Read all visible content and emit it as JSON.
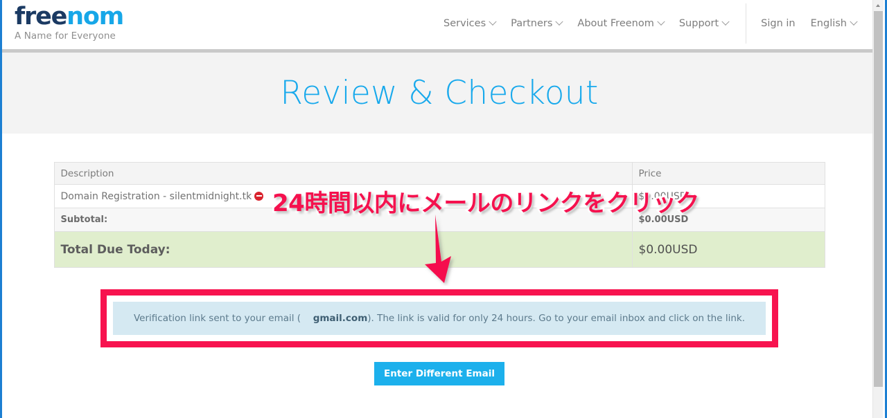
{
  "header": {
    "logo": {
      "part1": "free",
      "part2": "nom"
    },
    "tagline": "A Name for Everyone",
    "nav_items": [
      {
        "label": "Services",
        "has_chevron": true
      },
      {
        "label": "Partners",
        "has_chevron": true
      },
      {
        "label": "About Freenom",
        "has_chevron": true
      },
      {
        "label": "Support",
        "has_chevron": true
      }
    ],
    "sign_in": "Sign in",
    "language": "English"
  },
  "hero": {
    "title": "Review & Checkout"
  },
  "order_table": {
    "columns": [
      "Description",
      "Price"
    ],
    "rows": [
      {
        "description": "Domain Registration - silentmidnight.tk",
        "price": "$0.00USD",
        "removable": true
      },
      {
        "description": "Subtotal:",
        "price": "$0.00USD",
        "removable": false
      },
      {
        "description": "Total Due Today:",
        "price": "$0.00USD",
        "removable": false
      }
    ]
  },
  "notice": {
    "text_before": "Verification link sent to your email (",
    "email_domain": "gmail.com",
    "text_after": "). The link is valid for only 24 hours. Go to your email inbox and click on the link."
  },
  "actions": {
    "enter_different_email": "Enter Different Email"
  },
  "annotations": {
    "callout_text": "24時間以内にメールのリンクをクリック",
    "arrow": "down-arrow"
  },
  "colors": {
    "brand_dark": "#1b3a63",
    "brand_cyan": "#17a7e8",
    "hero_title": "#18a9ec",
    "total_row_bg": "#e0eecd",
    "notice_bg": "#d5e9f2",
    "button": "#1cb0ec",
    "annotation_pink": "#f5114e",
    "remove_icon": "#d9232d"
  }
}
